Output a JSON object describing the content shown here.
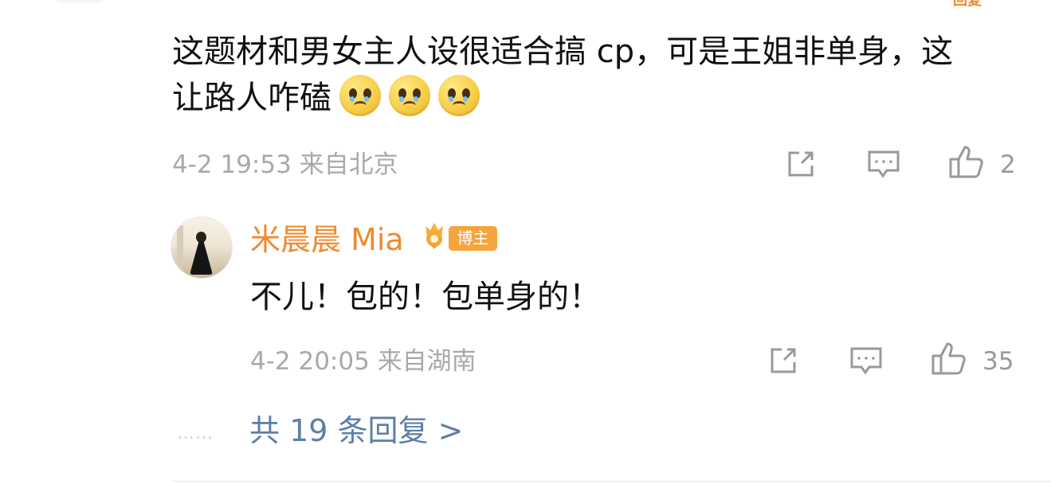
{
  "top_partial": {
    "text": "回复"
  },
  "main_comment": {
    "text": "这题材和男女主人设很适合搞 cp，可是王姐非单身，这让路人咋磕",
    "emoji_icons": [
      "crying-face-emoji-icon",
      "crying-face-emoji-icon",
      "crying-face-emoji-icon"
    ],
    "date_time": "4-2 19:53",
    "location": "来自北京",
    "likes": "2",
    "icons": [
      "share-icon",
      "comment-icon",
      "like-icon"
    ]
  },
  "reply": {
    "username": "米晨晨 Mia",
    "badge": "博主",
    "text": "不儿！包的！包单身的！",
    "date_time": "4-2 20:05",
    "location": "来自湖南",
    "likes": "35",
    "icons": [
      "avatar-image",
      "crown-badge-icon",
      "share-icon",
      "comment-icon",
      "like-icon"
    ]
  },
  "replies_link": {
    "dots": "……",
    "label": "共 19 条回复 >"
  },
  "colors": {
    "username": "#f08a2c",
    "link": "#5c7fa8",
    "meta": "#a9a9a9",
    "icon": "#999999",
    "badge": "#f6a43d"
  }
}
